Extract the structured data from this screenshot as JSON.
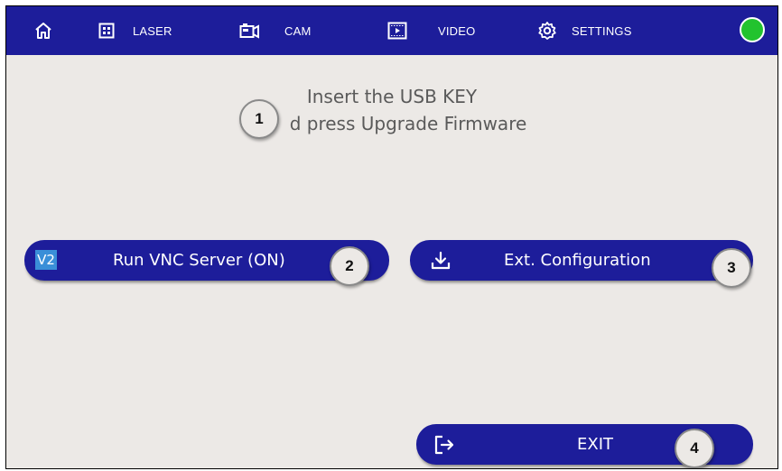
{
  "topbar": {
    "home_icon": "home-icon",
    "laser_icon": "grid-icon",
    "laser_label": "LASER",
    "cam_icon": "camera-icon",
    "cam_label": "CAM",
    "video_icon": "film-icon",
    "video_label": "VIDEO",
    "settings_icon": "gear-icon",
    "settings_label": "SETTINGS",
    "status_color": "#22c32e"
  },
  "message": {
    "line1": "Insert the USB KEY",
    "line2": "d press Upgrade Firmware"
  },
  "buttons": {
    "vnc_label": "Run VNC Server (ON)",
    "vnc_logo": "V2",
    "ext_label": "Ext. Configuration",
    "ext_icon": "download-icon",
    "exit_label": "EXIT",
    "exit_icon": "logout-icon"
  },
  "callouts": [
    "1",
    "2",
    "3",
    "4"
  ],
  "colors": {
    "bar": "#1d1d9a",
    "background": "#ece9e6",
    "status": "#22c32e"
  }
}
